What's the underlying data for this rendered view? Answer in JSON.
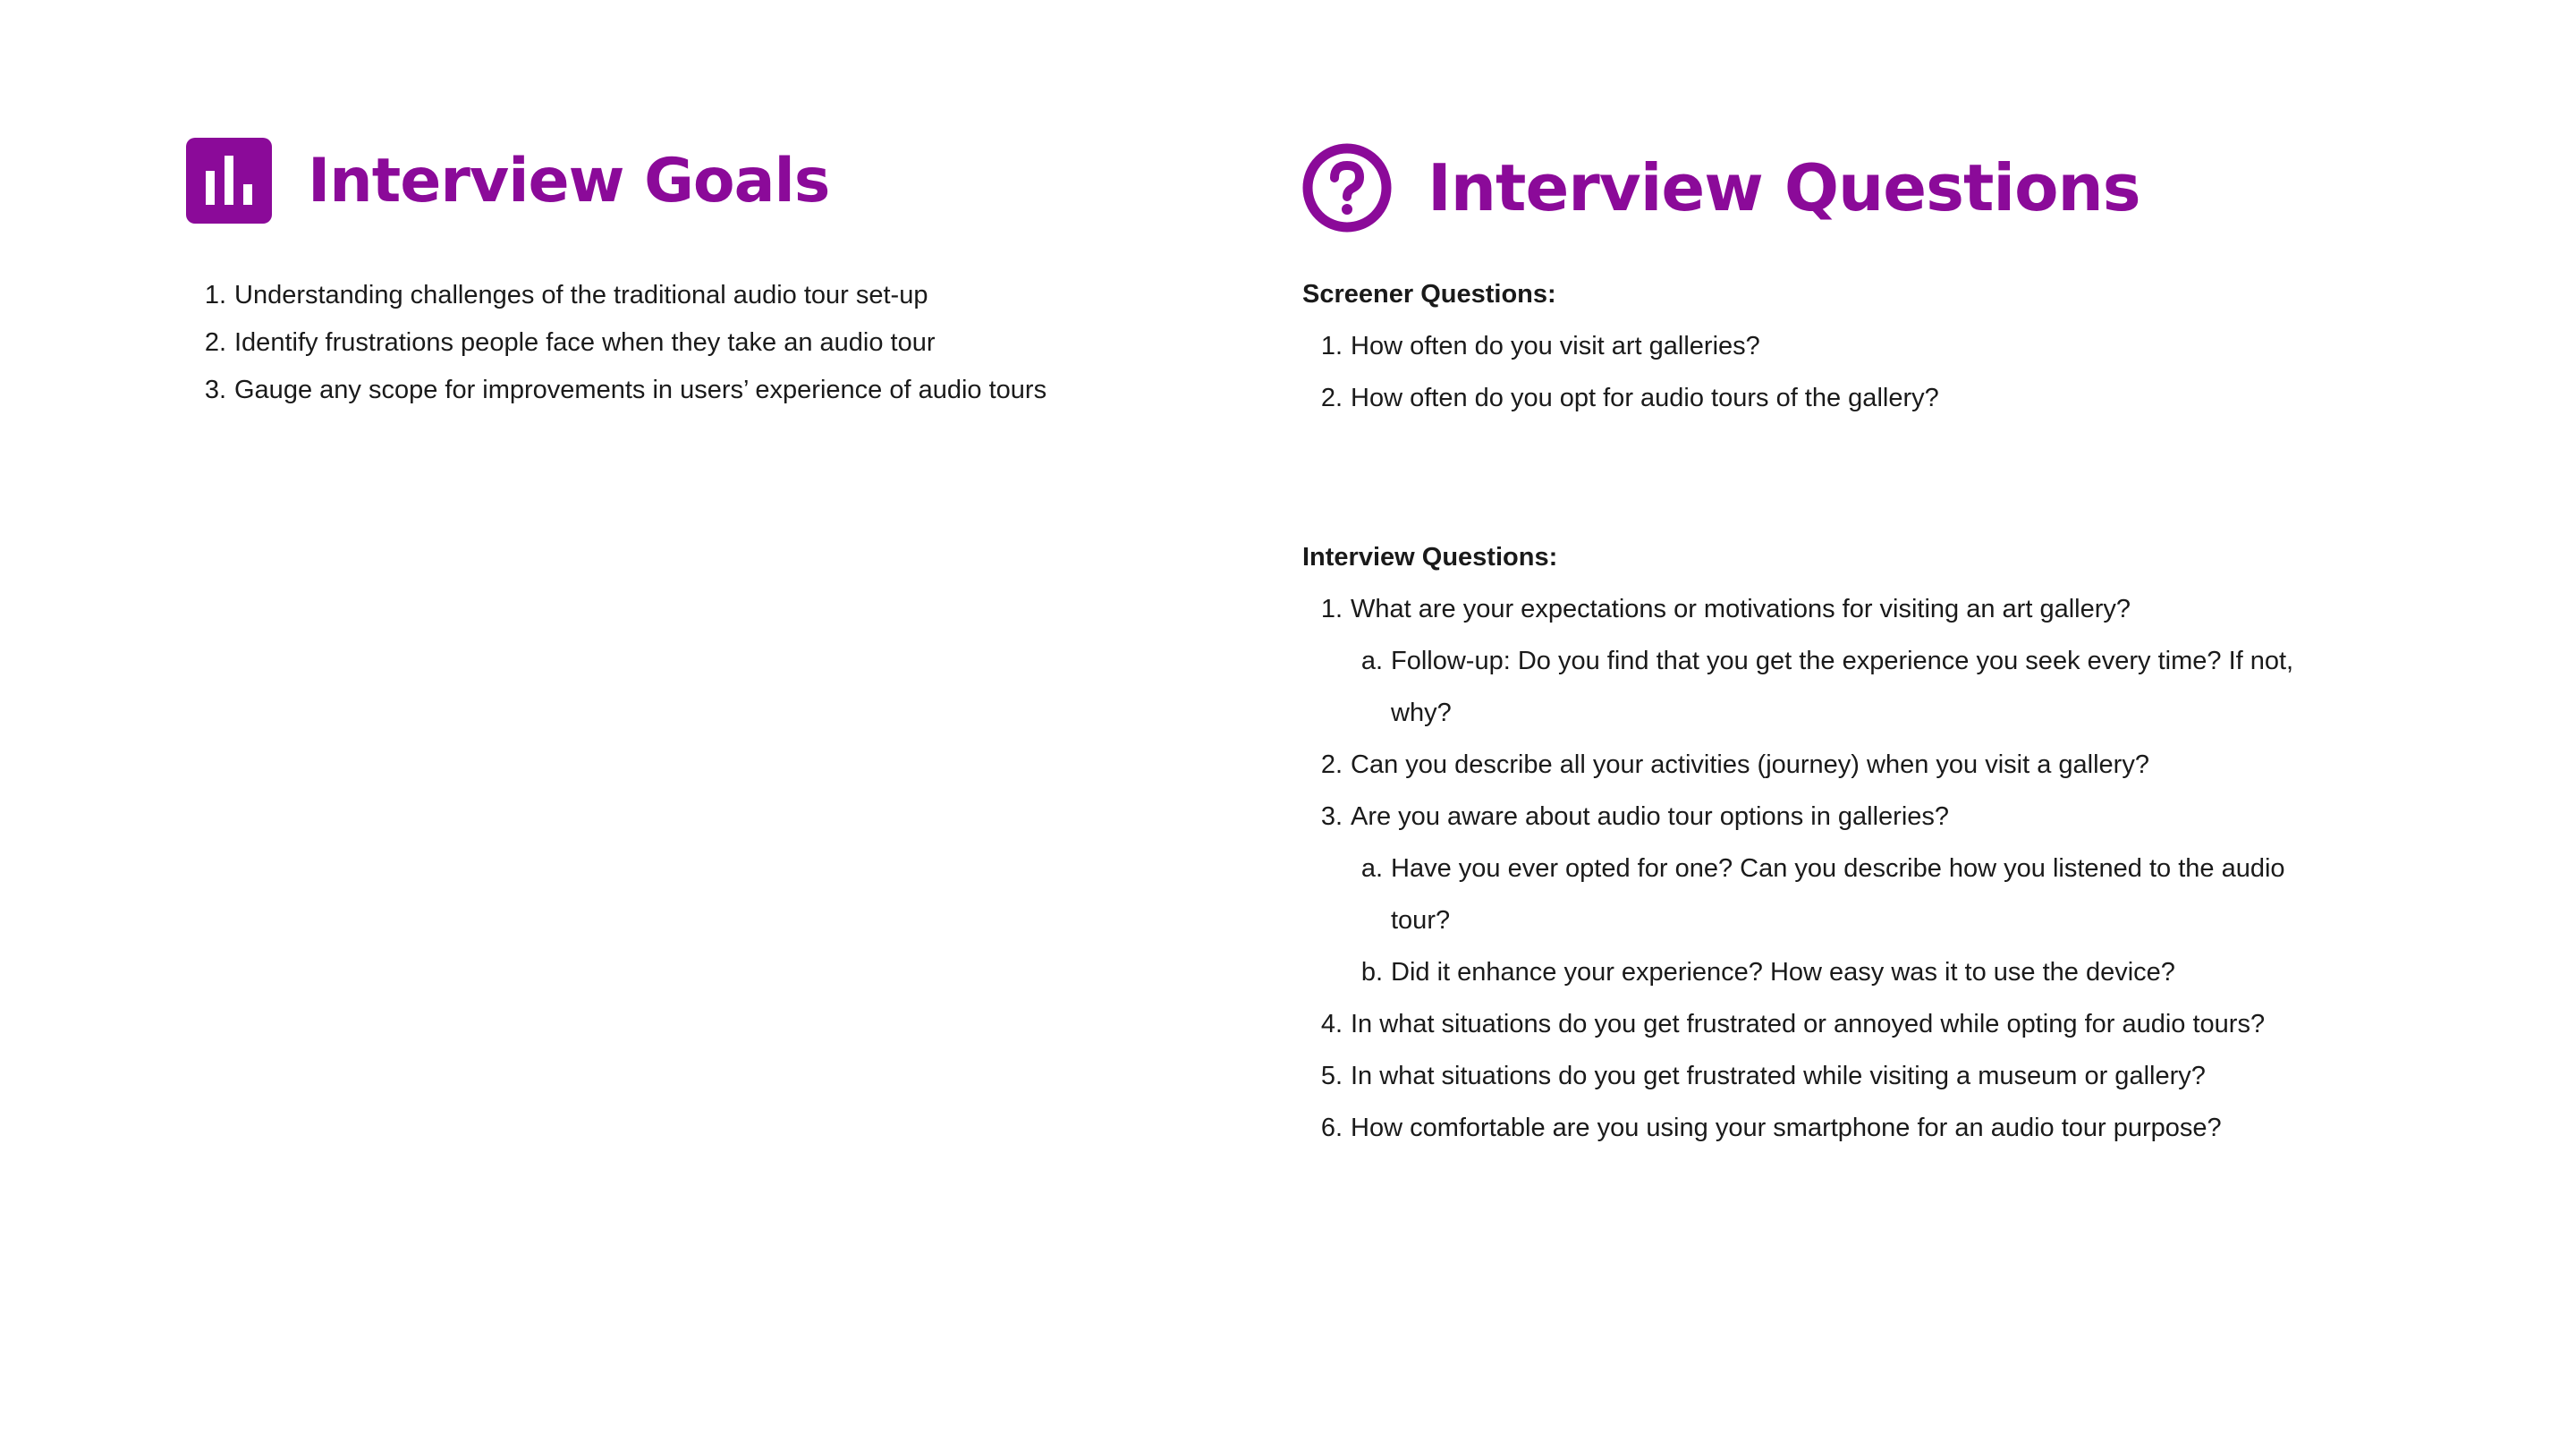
{
  "goals": {
    "title": "Interview Goals",
    "icon": "bar-chart-icon",
    "items": [
      "Understanding challenges of the traditional audio tour set-up",
      "Identify frustrations people face when they take an audio tour",
      "Gauge any scope for improvements in users’ experience of audio tours"
    ]
  },
  "questions": {
    "title": "Interview Questions",
    "icon": "question-circle-icon",
    "screener": {
      "label": "Screener Questions:",
      "items": [
        "How often do you visit art galleries?",
        "How often do you opt for audio tours of the gallery?"
      ]
    },
    "interview": {
      "label": "Interview Questions:",
      "items": [
        {
          "text": "What are your expectations or motivations for visiting an art gallery?",
          "sub": [
            "Follow-up: Do you find that you get the experience you seek every time? If not, why?"
          ]
        },
        {
          "text": "Can you describe all your activities (journey) when you visit a gallery?",
          "sub": []
        },
        {
          "text": "Are you aware about audio tour options in galleries?",
          "sub": [
            "Have you ever opted for one? Can you describe how you listened to the audio tour?",
            "Did it enhance your experience? How easy was it to use the device?"
          ]
        },
        {
          "text": "In what situations do you get frustrated or annoyed while opting for audio tours?",
          "sub": []
        },
        {
          "text": "In what situations do you get frustrated while visiting a museum or gallery?",
          "sub": []
        },
        {
          "text": "How comfortable are you using your smartphone for an audio tour purpose?",
          "sub": []
        }
      ]
    }
  },
  "colors": {
    "accent": "#8b0a99",
    "text": "#1a1a1a",
    "background": "#ffffff"
  }
}
